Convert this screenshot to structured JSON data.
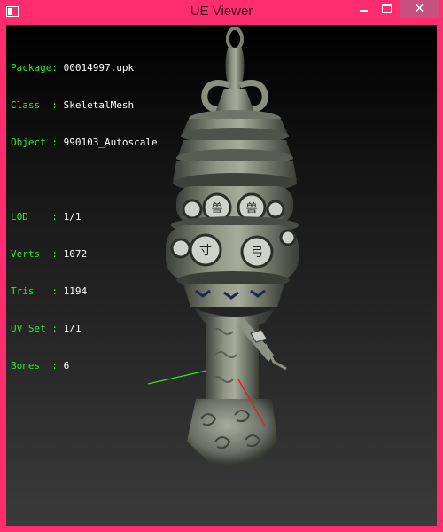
{
  "window": {
    "title": "UE Viewer",
    "accent_color": "#ff2d6f",
    "controls": {
      "minimize_icon": "minimize-icon",
      "maximize_icon": "maximize-icon",
      "close_icon": "close-icon",
      "close_glyph": "✕"
    }
  },
  "info_panel": {
    "package": {
      "label": "Package:",
      "value": "00014997.upk"
    },
    "class": {
      "label": "Class  :",
      "value": "SkeletalMesh"
    },
    "object": {
      "label": "Object :",
      "value": "990103_Autoscale"
    },
    "lod": {
      "label": "LOD    :",
      "value": "1/1"
    },
    "verts": {
      "label": "Verts  :",
      "value": "1072"
    },
    "tris": {
      "label": "Tris   :",
      "value": "1194"
    },
    "uv_set": {
      "label": "UV Set :",
      "value": "1/1"
    },
    "bones": {
      "label": "Bones  :",
      "value": "6"
    }
  },
  "viewport": {
    "model": "skeletal-mesh-pagoda-lantern",
    "axis_colors": {
      "x": "#33dd33",
      "y": "#dd2222"
    }
  }
}
